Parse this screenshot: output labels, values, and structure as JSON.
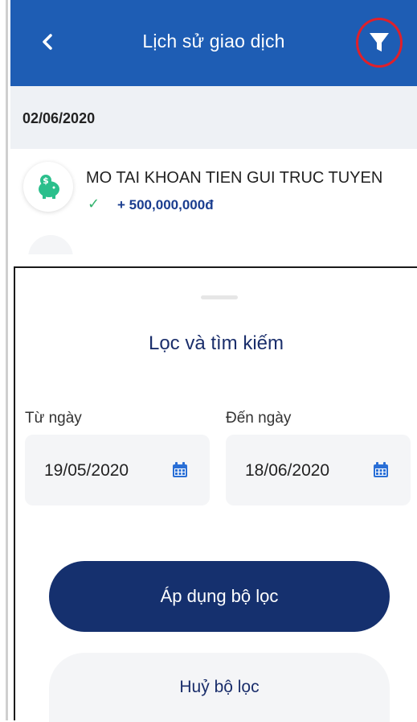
{
  "header": {
    "title": "Lịch sử giao dịch",
    "back_icon": "chevron-left-icon",
    "filter_icon": "filter-funnel-icon",
    "filter_highlight_color": "#e0202a",
    "bg_color": "#1e5db4"
  },
  "history": {
    "date_group": "02/06/2020",
    "transactions": [
      {
        "title": "MO TAI KHOAN TIEN GUI TRUC TUYEN",
        "status_icon": "check-icon",
        "amount": "+ 500,000,000đ",
        "icon": "piggy-bank-icon"
      }
    ]
  },
  "filter_sheet": {
    "title": "Lọc và tìm kiếm",
    "from_label": "Từ ngày",
    "from_value": "19/05/2020",
    "to_label": "Đến ngày",
    "to_value": "18/06/2020",
    "calendar_icon": "calendar-icon",
    "apply_label": "Áp dụng bộ lọc",
    "cancel_label": "Huỷ bộ lọc",
    "primary_color": "#15306e"
  }
}
